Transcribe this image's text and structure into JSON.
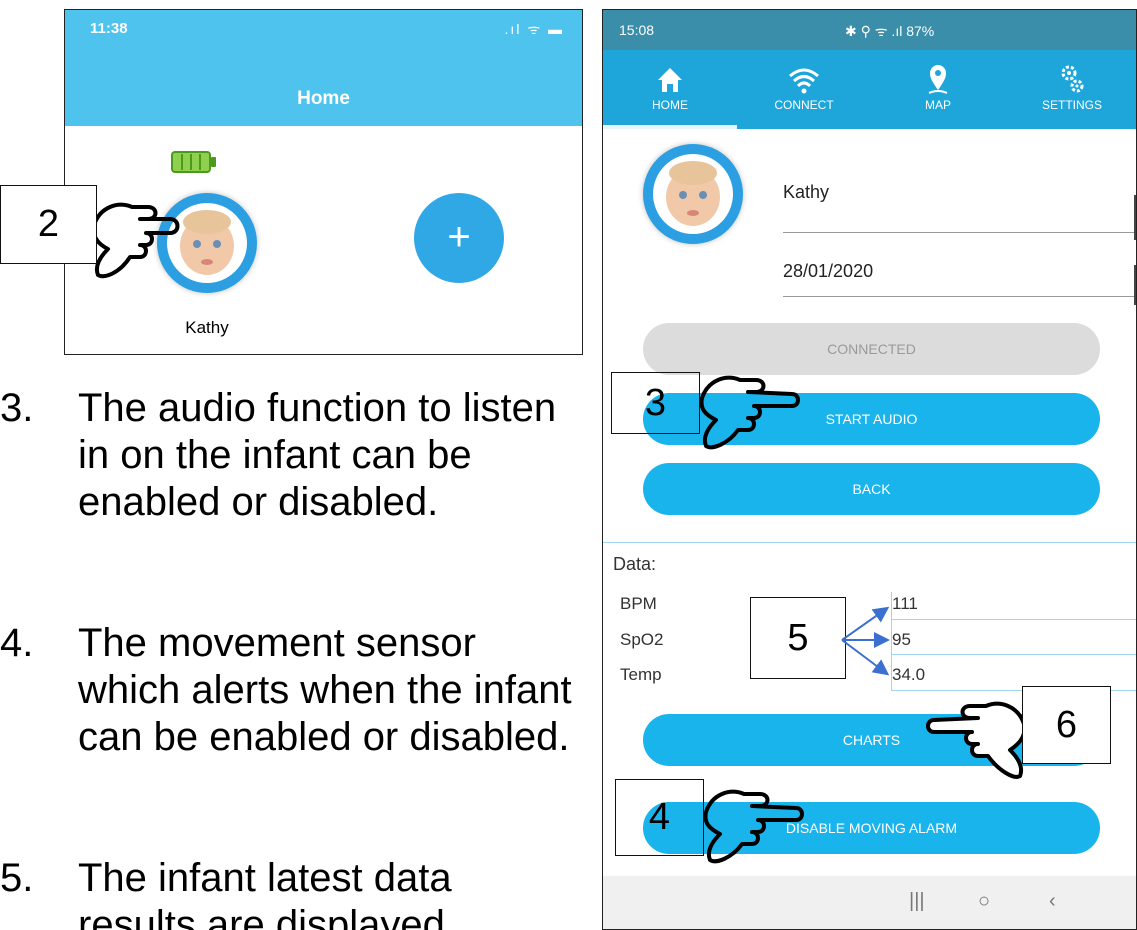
{
  "left_phone": {
    "time": "11:38",
    "status_icons": ".ıl ᯤ ▬",
    "title": "Home",
    "profile_name": "Kathy",
    "add_label": "+"
  },
  "callouts": {
    "c2": "2",
    "c3": "3",
    "c4": "4",
    "c5": "5",
    "c6": "6"
  },
  "steps": [
    {
      "num": "3.",
      "text": "The audio function to listen in on the  infant can be enabled  or disabled."
    },
    {
      "num": "4.",
      "text": "The movement sensor which alerts when the infant can be enabled or  disabled."
    },
    {
      "num": "5.",
      "text": "The infant latest data results are displayed"
    }
  ],
  "right_phone": {
    "status_time": "15:08",
    "status_right": "✱ ⚲ ᯤ .ıl 87%",
    "nav": [
      {
        "label": "HOME",
        "icon": "home-icon"
      },
      {
        "label": "CONNECT",
        "icon": "wifi-icon"
      },
      {
        "label": "MAP",
        "icon": "map-pin-icon"
      },
      {
        "label": "SETTINGS",
        "icon": "gear-icon"
      }
    ],
    "profile_name": "Kathy",
    "profile_date": "28/01/2020",
    "buttons": {
      "connected": "CONNECTED",
      "start_audio": "START AUDIO",
      "back": "BACK",
      "charts": "CHARTS",
      "alarm": "DISABLE MOVING ALARM"
    },
    "data": {
      "heading": "Data:",
      "rows": [
        {
          "label": "BPM",
          "value": "111"
        },
        {
          "label": "SpO2",
          "value": "95"
        },
        {
          "label": "Temp",
          "value": "34.0"
        }
      ]
    },
    "bottom_nav": {
      "recent": "|||",
      "home": "○",
      "back": "‹"
    }
  },
  "colors": {
    "ios_header": "#4ec3ee",
    "app_nav": "#1ea6db",
    "button_blue": "#1ab4ec",
    "button_disabled": "#dcdcdc",
    "arrow_blue": "#3b6fd0"
  }
}
